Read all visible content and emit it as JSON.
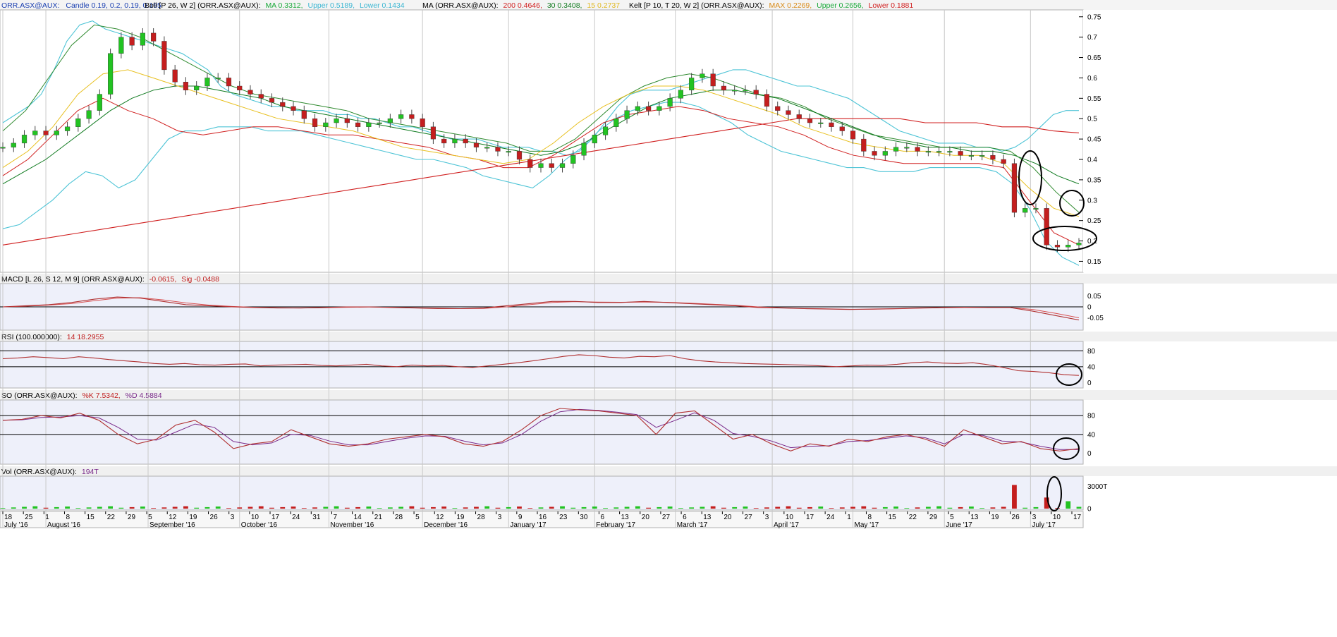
{
  "header": {
    "symbol": "ORR.ASX@AUX:",
    "candle_label": "Candle 0.19, 0.2, 0.19, 0.195",
    "boll_label": "Boll [P 26, W 2] (ORR.ASX@AUX):",
    "boll_ma": "MA 0.3312,",
    "boll_upper": "Upper 0.5189,",
    "boll_lower": "Lower 0.1434",
    "ma_label": "MA (ORR.ASX@AUX):",
    "ma_200": "200 0.4646,",
    "ma_30": "30 0.3408,",
    "ma_15": "15 0.2737",
    "kelt_label": "Kelt [P 10, T 20, W 2] (ORR.ASX@AUX):",
    "kelt_max": "MAX 0.2269,",
    "kelt_upper": "Upper 0.2656,",
    "kelt_lower": "Lower 0.1881"
  },
  "panels": {
    "macd": {
      "label": "MACD [L 26, S 12, M 9] (ORR.ASX@AUX):",
      "value": "-0.0615,",
      "sig": "Sig -0.0488"
    },
    "rsi": {
      "label": "RSI (100.000000):",
      "value": "14 18.2955"
    },
    "so": {
      "label": "SO (ORR.ASX@AUX):",
      "k": "%K 7.5342,",
      "d": "%D 4.5884"
    },
    "vol": {
      "label": "Vol (ORR.ASX@AUX):",
      "value": "194T"
    }
  },
  "colors": {
    "up": "#22c322",
    "down": "#c41e1e",
    "boll": "#4ec4d6",
    "ma200": "#d02020",
    "ma30": "#0f7a1f",
    "ma15": "#e8c020",
    "kelt": "#2f8a2f",
    "macd": "#b03030",
    "grid": "#c8c8c8",
    "band_bg": "#eef0fa"
  },
  "chart_data": [
    {
      "type": "candlestick",
      "name": "price",
      "ylim": [
        0.13,
        0.76
      ],
      "yticks": [
        0.15,
        0.2,
        0.25,
        0.3,
        0.35,
        0.4,
        0.45,
        0.5,
        0.55,
        0.6,
        0.65,
        0.7,
        0.75
      ],
      "close_series": [
        0.43,
        0.44,
        0.46,
        0.47,
        0.46,
        0.47,
        0.48,
        0.5,
        0.52,
        0.56,
        0.66,
        0.7,
        0.68,
        0.71,
        0.69,
        0.62,
        0.59,
        0.57,
        0.58,
        0.6,
        0.6,
        0.58,
        0.57,
        0.56,
        0.55,
        0.54,
        0.53,
        0.52,
        0.5,
        0.48,
        0.49,
        0.5,
        0.49,
        0.48,
        0.49,
        0.49,
        0.5,
        0.51,
        0.5,
        0.48,
        0.45,
        0.44,
        0.45,
        0.44,
        0.43,
        0.43,
        0.42,
        0.42,
        0.4,
        0.38,
        0.39,
        0.38,
        0.39,
        0.41,
        0.44,
        0.46,
        0.48,
        0.5,
        0.52,
        0.53,
        0.52,
        0.53,
        0.55,
        0.57,
        0.6,
        0.61,
        0.58,
        0.57,
        0.57,
        0.57,
        0.56,
        0.53,
        0.52,
        0.51,
        0.5,
        0.49,
        0.49,
        0.48,
        0.47,
        0.45,
        0.42,
        0.41,
        0.42,
        0.43,
        0.43,
        0.42,
        0.42,
        0.42,
        0.42,
        0.41,
        0.41,
        0.41,
        0.4,
        0.39,
        0.27,
        0.28,
        0.28,
        0.19,
        0.185,
        0.19,
        0.195
      ],
      "boll_upper": [
        0.49,
        0.51,
        0.53,
        0.56,
        0.62,
        0.69,
        0.73,
        0.74,
        0.72,
        0.71,
        0.7,
        0.69,
        0.68,
        0.67,
        0.66,
        0.64,
        0.62,
        0.58,
        0.56,
        0.55,
        0.54,
        0.53,
        0.53,
        0.52,
        0.52,
        0.52,
        0.51,
        0.51,
        0.5,
        0.5,
        0.49,
        0.48,
        0.48,
        0.47,
        0.46,
        0.45,
        0.45,
        0.45,
        0.44,
        0.43,
        0.43,
        0.43,
        0.42,
        0.42,
        0.41,
        0.42,
        0.45,
        0.49,
        0.53,
        0.56,
        0.57,
        0.57,
        0.57,
        0.58,
        0.59,
        0.6,
        0.61,
        0.62,
        0.62,
        0.61,
        0.6,
        0.59,
        0.58,
        0.58,
        0.57,
        0.56,
        0.55,
        0.53,
        0.51,
        0.49,
        0.47,
        0.46,
        0.45,
        0.44,
        0.44,
        0.44,
        0.43,
        0.43,
        0.42,
        0.43,
        0.45,
        0.48,
        0.51,
        0.52,
        0.52
      ],
      "boll_lower": [
        0.23,
        0.24,
        0.27,
        0.3,
        0.34,
        0.37,
        0.36,
        0.33,
        0.35,
        0.4,
        0.45,
        0.47,
        0.47,
        0.48,
        0.48,
        0.48,
        0.47,
        0.47,
        0.47,
        0.46,
        0.45,
        0.44,
        0.43,
        0.42,
        0.41,
        0.4,
        0.4,
        0.39,
        0.38,
        0.36,
        0.35,
        0.34,
        0.33,
        0.36,
        0.4,
        0.43,
        0.47,
        0.5,
        0.52,
        0.53,
        0.54,
        0.54,
        0.53,
        0.51,
        0.49,
        0.46,
        0.44,
        0.42,
        0.41,
        0.4,
        0.39,
        0.38,
        0.38,
        0.37,
        0.37,
        0.37,
        0.38,
        0.38,
        0.38,
        0.38,
        0.37,
        0.34,
        0.28,
        0.2,
        0.16,
        0.14
      ],
      "ma200": [
        0.19,
        0.2,
        0.21,
        0.22,
        0.23,
        0.24,
        0.25,
        0.26,
        0.27,
        0.28,
        0.29,
        0.3,
        0.31,
        0.32,
        0.33,
        0.34,
        0.35,
        0.36,
        0.37,
        0.38,
        0.39,
        0.4,
        0.41,
        0.42,
        0.43,
        0.44,
        0.45,
        0.46,
        0.47,
        0.48,
        0.49,
        0.5,
        0.5,
        0.5,
        0.5,
        0.5,
        0.49,
        0.49,
        0.49,
        0.48,
        0.48,
        0.47,
        0.465
      ],
      "ma30": [
        0.34,
        0.37,
        0.4,
        0.44,
        0.48,
        0.52,
        0.55,
        0.57,
        0.58,
        0.58,
        0.57,
        0.56,
        0.55,
        0.53,
        0.52,
        0.51,
        0.5,
        0.49,
        0.48,
        0.47,
        0.46,
        0.45,
        0.44,
        0.43,
        0.42,
        0.41,
        0.42,
        0.44,
        0.47,
        0.5,
        0.53,
        0.55,
        0.56,
        0.57,
        0.57,
        0.56,
        0.55,
        0.53,
        0.51,
        0.49,
        0.47,
        0.45,
        0.44,
        0.43,
        0.43,
        0.42,
        0.42,
        0.41,
        0.39,
        0.36,
        0.34
      ],
      "ma15": [
        0.38,
        0.42,
        0.48,
        0.56,
        0.61,
        0.62,
        0.6,
        0.58,
        0.56,
        0.54,
        0.52,
        0.5,
        0.49,
        0.48,
        0.47,
        0.45,
        0.43,
        0.42,
        0.41,
        0.4,
        0.39,
        0.4,
        0.44,
        0.49,
        0.53,
        0.56,
        0.58,
        0.58,
        0.57,
        0.55,
        0.53,
        0.51,
        0.48,
        0.46,
        0.44,
        0.43,
        0.42,
        0.42,
        0.41,
        0.41,
        0.39,
        0.33,
        0.28,
        0.26
      ],
      "kelt_upper": [
        0.47,
        0.52,
        0.6,
        0.68,
        0.73,
        0.72,
        0.7,
        0.67,
        0.64,
        0.61,
        0.58,
        0.56,
        0.55,
        0.54,
        0.53,
        0.52,
        0.5,
        0.49,
        0.48,
        0.47,
        0.46,
        0.45,
        0.44,
        0.42,
        0.42,
        0.45,
        0.5,
        0.55,
        0.58,
        0.6,
        0.61,
        0.6,
        0.58,
        0.56,
        0.55,
        0.53,
        0.5,
        0.48,
        0.46,
        0.45,
        0.44,
        0.43,
        0.43,
        0.43,
        0.42,
        0.38,
        0.32,
        0.27
      ],
      "kelt_lower": [
        0.36,
        0.4,
        0.46,
        0.52,
        0.55,
        0.52,
        0.5,
        0.47,
        0.46,
        0.47,
        0.48,
        0.48,
        0.47,
        0.46,
        0.46,
        0.45,
        0.44,
        0.43,
        0.41,
        0.4,
        0.38,
        0.38,
        0.41,
        0.45,
        0.49,
        0.51,
        0.52,
        0.53,
        0.52,
        0.5,
        0.49,
        0.48,
        0.46,
        0.43,
        0.41,
        0.4,
        0.39,
        0.39,
        0.39,
        0.39,
        0.38,
        0.3,
        0.22,
        0.19
      ]
    },
    {
      "type": "line",
      "name": "macd",
      "ylim": [
        -0.1,
        0.1
      ],
      "yticks": [
        0.05,
        0,
        -0.05
      ],
      "ytick_labels": [
        "0.05",
        "0",
        "-0.05"
      ],
      "values": [
        0,
        0.005,
        0.01,
        0.02,
        0.035,
        0.045,
        0.04,
        0.025,
        0.01,
        0.005,
        0.0,
        -0.003,
        -0.005,
        -0.005,
        -0.003,
        0.0,
        0.0,
        -0.003,
        -0.005,
        -0.008,
        -0.008,
        -0.005,
        0.005,
        0.015,
        0.025,
        0.025,
        0.02,
        0.02,
        0.025,
        0.02,
        0.015,
        0.01,
        0.005,
        -0.003,
        -0.005,
        -0.008,
        -0.01,
        -0.012,
        -0.01,
        -0.008,
        -0.005,
        -0.003,
        -0.002,
        -0.003,
        -0.003,
        -0.02,
        -0.04,
        -0.06
      ],
      "signal": [
        0,
        0.003,
        0.008,
        0.015,
        0.028,
        0.04,
        0.042,
        0.032,
        0.018,
        0.008,
        0.002,
        -0.002,
        -0.004,
        -0.005,
        -0.004,
        -0.002,
        -0.001,
        -0.002,
        -0.004,
        -0.006,
        -0.008,
        -0.007,
        0.0,
        0.01,
        0.02,
        0.024,
        0.022,
        0.021,
        0.022,
        0.021,
        0.017,
        0.012,
        0.007,
        0.0,
        -0.004,
        -0.007,
        -0.009,
        -0.011,
        -0.011,
        -0.009,
        -0.006,
        -0.004,
        -0.003,
        -0.003,
        -0.003,
        -0.012,
        -0.03,
        -0.05
      ]
    },
    {
      "type": "line",
      "name": "rsi",
      "ylim": [
        -10,
        100
      ],
      "yticks": [
        80,
        40,
        0
      ],
      "ytick_labels": [
        "80",
        "40",
        "0"
      ],
      "values": [
        60,
        62,
        65,
        63,
        60,
        65,
        62,
        58,
        55,
        52,
        48,
        46,
        48,
        45,
        44,
        46,
        47,
        42,
        44,
        45,
        46,
        43,
        42,
        44,
        46,
        42,
        40,
        44,
        42,
        43,
        40,
        38,
        42,
        46,
        50,
        55,
        60,
        66,
        70,
        68,
        64,
        62,
        66,
        65,
        68,
        60,
        55,
        52,
        50,
        48,
        47,
        46,
        45,
        44,
        42,
        40,
        42,
        44,
        43,
        46,
        50,
        52,
        49,
        48,
        50,
        45,
        38,
        30,
        28,
        25,
        20,
        18
      ]
    },
    {
      "type": "line",
      "name": "so",
      "ylim": [
        -20,
        110
      ],
      "yticks": [
        80,
        40,
        0
      ],
      "ytick_labels": [
        "80",
        "40",
        "0"
      ],
      "values": [
        70,
        72,
        80,
        75,
        85,
        70,
        40,
        20,
        30,
        60,
        70,
        45,
        10,
        20,
        25,
        50,
        35,
        20,
        15,
        20,
        30,
        35,
        40,
        35,
        20,
        15,
        25,
        50,
        80,
        95,
        92,
        90,
        85,
        80,
        40,
        85,
        90,
        60,
        30,
        40,
        20,
        5,
        20,
        15,
        30,
        25,
        35,
        40,
        30,
        15,
        50,
        35,
        20,
        25,
        10,
        5,
        10
      ],
      "signal": [
        70,
        71,
        76,
        77,
        80,
        75,
        55,
        30,
        28,
        45,
        62,
        55,
        25,
        18,
        22,
        40,
        38,
        26,
        18,
        18,
        25,
        32,
        37,
        36,
        26,
        18,
        22,
        40,
        68,
        88,
        93,
        91,
        87,
        82,
        55,
        70,
        86,
        70,
        42,
        36,
        26,
        12,
        15,
        16,
        25,
        27,
        32,
        37,
        33,
        20,
        40,
        38,
        26,
        24,
        15,
        8,
        8
      ]
    },
    {
      "type": "bar",
      "name": "volume",
      "ylim": [
        0,
        4200
      ],
      "yticks": [
        3000,
        0
      ],
      "ytick_labels": [
        "3000T",
        "0"
      ]
    }
  ],
  "xaxis": {
    "day_ticks": [
      "18",
      "25",
      "1",
      "8",
      "15",
      "22",
      "29",
      "5",
      "12",
      "19",
      "26",
      "3",
      "10",
      "17",
      "24",
      "31",
      "7",
      "14",
      "21",
      "28",
      "5",
      "12",
      "19",
      "28",
      "3",
      "9",
      "16",
      "23",
      "30",
      "6",
      "13",
      "20",
      "27",
      "6",
      "13",
      "20",
      "27",
      "3",
      "10",
      "17",
      "24",
      "1",
      "8",
      "15",
      "22",
      "29",
      "5",
      "13",
      "19",
      "26",
      "3",
      "10",
      "17"
    ],
    "month_labels": [
      "July '16",
      "August '16",
      "September '16",
      "October '16",
      "November '16",
      "December '16",
      "January '17",
      "February '17",
      "March '17",
      "April '17",
      "May '17",
      "June '17",
      "July '17"
    ]
  }
}
